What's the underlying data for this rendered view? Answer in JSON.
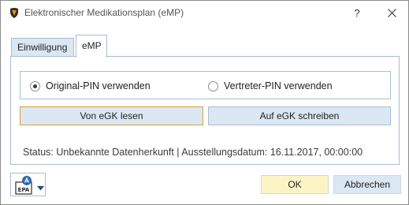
{
  "window": {
    "title": "Elektronischer Medikationsplan (eMP)",
    "help_label": "?",
    "icons": {
      "app": "app-logo-icon",
      "close": "close-icon"
    }
  },
  "tabs": [
    {
      "label": "Einwilligung",
      "active": false
    },
    {
      "label": "eMP",
      "active": true
    }
  ],
  "pin_options": [
    {
      "label": "Original-PIN verwenden",
      "checked": true
    },
    {
      "label": "Vertreter-PIN verwenden",
      "checked": false
    }
  ],
  "actions": {
    "read_label": "Von eGK lesen",
    "write_label": "Auf eGK schreiben"
  },
  "status": {
    "text": "Status: Unbekannte Datenherkunft | Ausstellungsdatum: 16.11.2017, 00:00:00"
  },
  "footer": {
    "epa_icon": "epa-icon",
    "epa_icon_text": "EPA",
    "ok_label": "OK",
    "cancel_label": "Abbrechen"
  },
  "colors": {
    "accent_border": "#e29b3a",
    "button_fill": "#dbe7f3",
    "ok_fill": "#fdf4c6",
    "frame_border": "#a9bdd3"
  }
}
